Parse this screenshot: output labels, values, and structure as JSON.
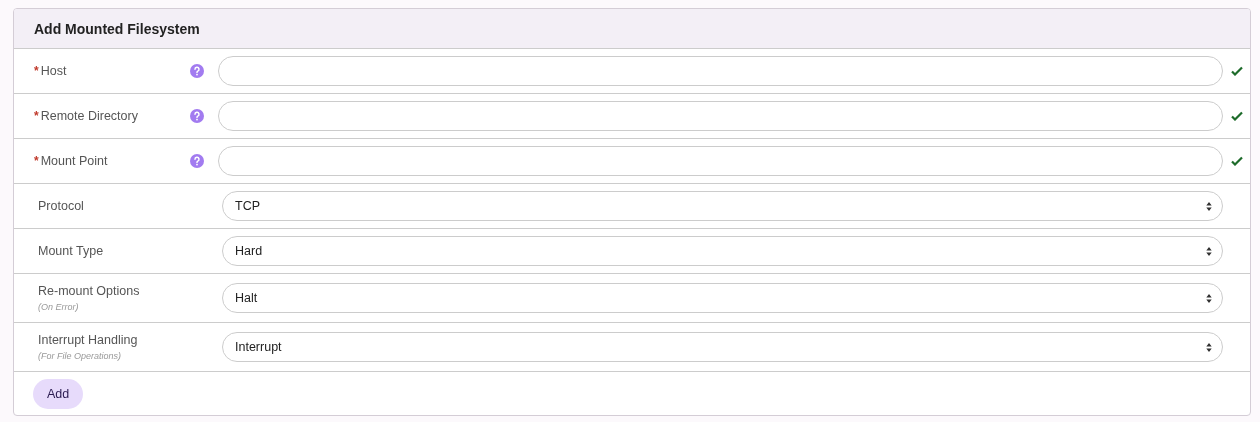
{
  "title": "Add Mounted Filesystem",
  "fields": [
    {
      "kind": "text",
      "label": "Host",
      "required_mark": "*",
      "help": true,
      "valid": true
    },
    {
      "kind": "text",
      "label": "Remote Directory",
      "required_mark": "*",
      "help": true,
      "valid": true
    },
    {
      "kind": "text",
      "label": "Mount Point",
      "required_mark": "*",
      "help": true,
      "valid": true
    },
    {
      "kind": "select",
      "label": "Protocol",
      "value": "TCP"
    },
    {
      "kind": "select",
      "label": "Mount Type",
      "value": "Hard"
    },
    {
      "kind": "select",
      "label": "Re-mount Options",
      "sublabel": "(On Error)",
      "value": "Halt"
    },
    {
      "kind": "select",
      "label": "Interrupt Handling",
      "sublabel": "(For File Operations)",
      "value": "Interrupt"
    }
  ],
  "button": "Add"
}
